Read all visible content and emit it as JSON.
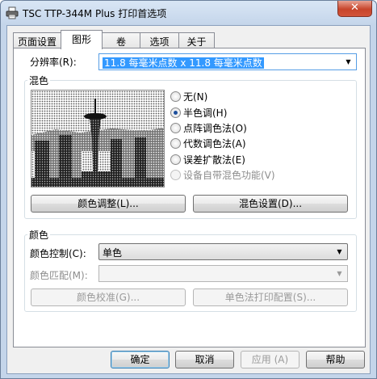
{
  "window": {
    "title": "TSC TTP-344M Plus 打印首选项",
    "close_glyph": "✕",
    "accent": "#3399ff",
    "close_color": "#c7452b"
  },
  "tabs": [
    {
      "label": "页面设置"
    },
    {
      "label": "图形"
    },
    {
      "label": "卷"
    },
    {
      "label": "选项"
    },
    {
      "label": "关于"
    }
  ],
  "active_tab": "图形",
  "resolution": {
    "label": "分辨率(R):",
    "value": "11.8 每毫米点数 x 11.8 每毫米点数"
  },
  "dither": {
    "title": "混色",
    "options": [
      {
        "label": "无(N)",
        "checked": false,
        "enabled": true
      },
      {
        "label": "半色调(H)",
        "checked": true,
        "enabled": true
      },
      {
        "label": "点阵调色法(O)",
        "checked": false,
        "enabled": true
      },
      {
        "label": "代数调色法(A)",
        "checked": false,
        "enabled": true
      },
      {
        "label": "误差扩散法(E)",
        "checked": false,
        "enabled": true
      },
      {
        "label": "设备自带混色功能(V)",
        "checked": false,
        "enabled": false
      }
    ],
    "adjust_button": "颜色调整(L)...",
    "settings_button": "混色设置(D)..."
  },
  "color": {
    "title": "颜色",
    "control_label": "颜色控制(C):",
    "control_value": "单色",
    "match_label": "颜色匹配(M):",
    "match_value": "",
    "calibrate_button": "颜色校准(G)...",
    "monochrome_print_button": "单色法打印配置(S)..."
  },
  "footer": {
    "ok": "确定",
    "cancel": "取消",
    "apply": "应用 (A)",
    "help": "帮助"
  }
}
